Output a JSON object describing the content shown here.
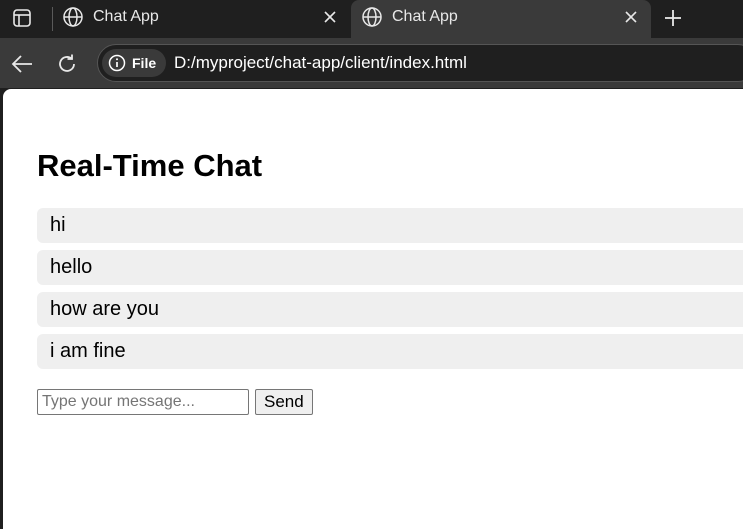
{
  "browser": {
    "tabs": [
      {
        "title": "Chat App",
        "active": false,
        "icon": "globe-icon"
      },
      {
        "title": "Chat App",
        "active": true,
        "icon": "globe-icon"
      }
    ],
    "toolbar": {
      "site_chip_label": "File",
      "url": "D:/myproject/chat-app/client/index.html"
    }
  },
  "page": {
    "title": "Real-Time Chat",
    "messages": [
      "hi",
      "hello",
      "how are you",
      "i am fine"
    ],
    "composer": {
      "input_placeholder": "Type your message...",
      "input_value": "",
      "send_label": "Send"
    }
  },
  "colors": {
    "tabstrip_bg": "#1f1f1f",
    "active_tab_bg": "#3a3a3a",
    "message_bg": "#efefef",
    "page_bg": "#ffffff"
  }
}
